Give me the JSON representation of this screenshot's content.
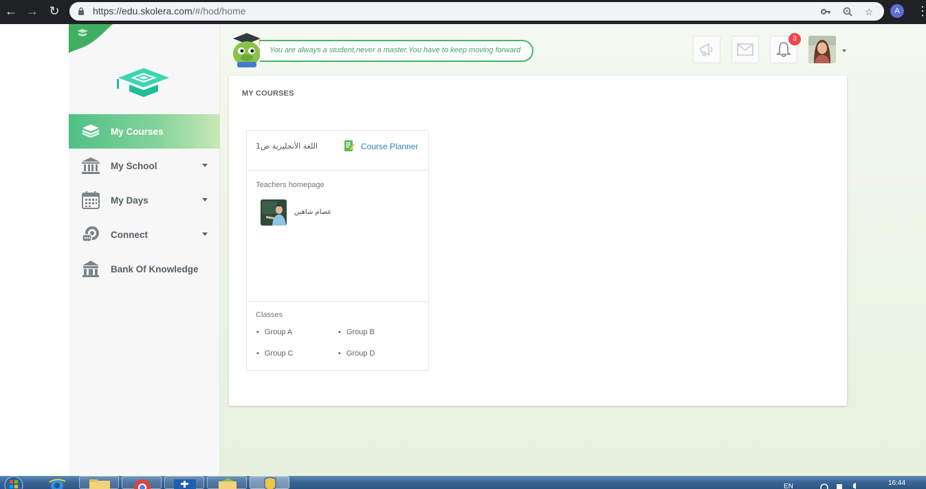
{
  "browser": {
    "url_host": "https://edu.skolera.com",
    "url_path": "/#/hod/home",
    "profile_letter": "A"
  },
  "header": {
    "quote": "You are always a student,never a master.You have to keep moving forward",
    "notification_count": "3"
  },
  "sidebar": {
    "items": [
      {
        "label": "My Courses",
        "icon": "books-icon",
        "active": true,
        "has_dropdown": false
      },
      {
        "label": "My School",
        "icon": "school-building-icon",
        "active": false,
        "has_dropdown": true
      },
      {
        "label": "My Days",
        "icon": "calendar-icon",
        "active": false,
        "has_dropdown": true
      },
      {
        "label": "Connect",
        "icon": "chat-bubbles-icon",
        "active": false,
        "has_dropdown": true
      },
      {
        "label": "Bank Of Knowledge",
        "icon": "bank-icon",
        "active": false,
        "has_dropdown": false
      }
    ]
  },
  "main": {
    "title": "MY COURSES",
    "course": {
      "name": "اللغة الأنجليزية ص1",
      "planner_label": "Course Planner",
      "teachers_label": "Teachers homepage",
      "teacher_name": "عصام شاهين",
      "classes_label": "Classes",
      "classes": [
        "Group A",
        "Group B",
        "Group C",
        "Group D"
      ]
    }
  },
  "taskbar": {
    "lang": "EN",
    "time": "16:44"
  },
  "colors": {
    "accent_green": "#4fc084",
    "link_blue": "#2d7fb8",
    "badge_red": "#f0454d"
  }
}
